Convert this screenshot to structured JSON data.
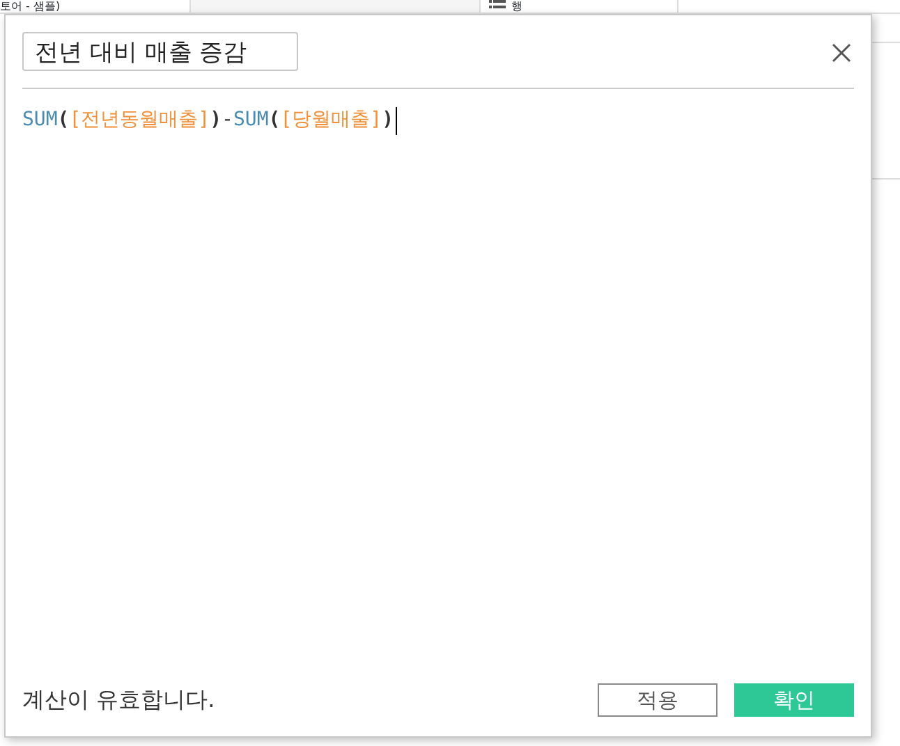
{
  "background": {
    "data_source": "토어 - 샘플)",
    "shelf_label": "행"
  },
  "dialog": {
    "name_field": "전년 대비 매출 증감",
    "formula": [
      {
        "kind": "function",
        "text": "SUM"
      },
      {
        "kind": "paren",
        "text": "("
      },
      {
        "kind": "field",
        "text": "[전년동월매출]"
      },
      {
        "kind": "paren",
        "text": ")"
      },
      {
        "kind": "operator",
        "text": "-"
      },
      {
        "kind": "function",
        "text": "SUM"
      },
      {
        "kind": "paren",
        "text": "("
      },
      {
        "kind": "field",
        "text": "[당월매출]"
      },
      {
        "kind": "paren",
        "text": ")"
      }
    ],
    "status": "계산이 유효합니다.",
    "buttons": [
      {
        "kind": "secondary",
        "label": "적용"
      },
      {
        "kind": "primary",
        "label": "확인"
      }
    ]
  }
}
